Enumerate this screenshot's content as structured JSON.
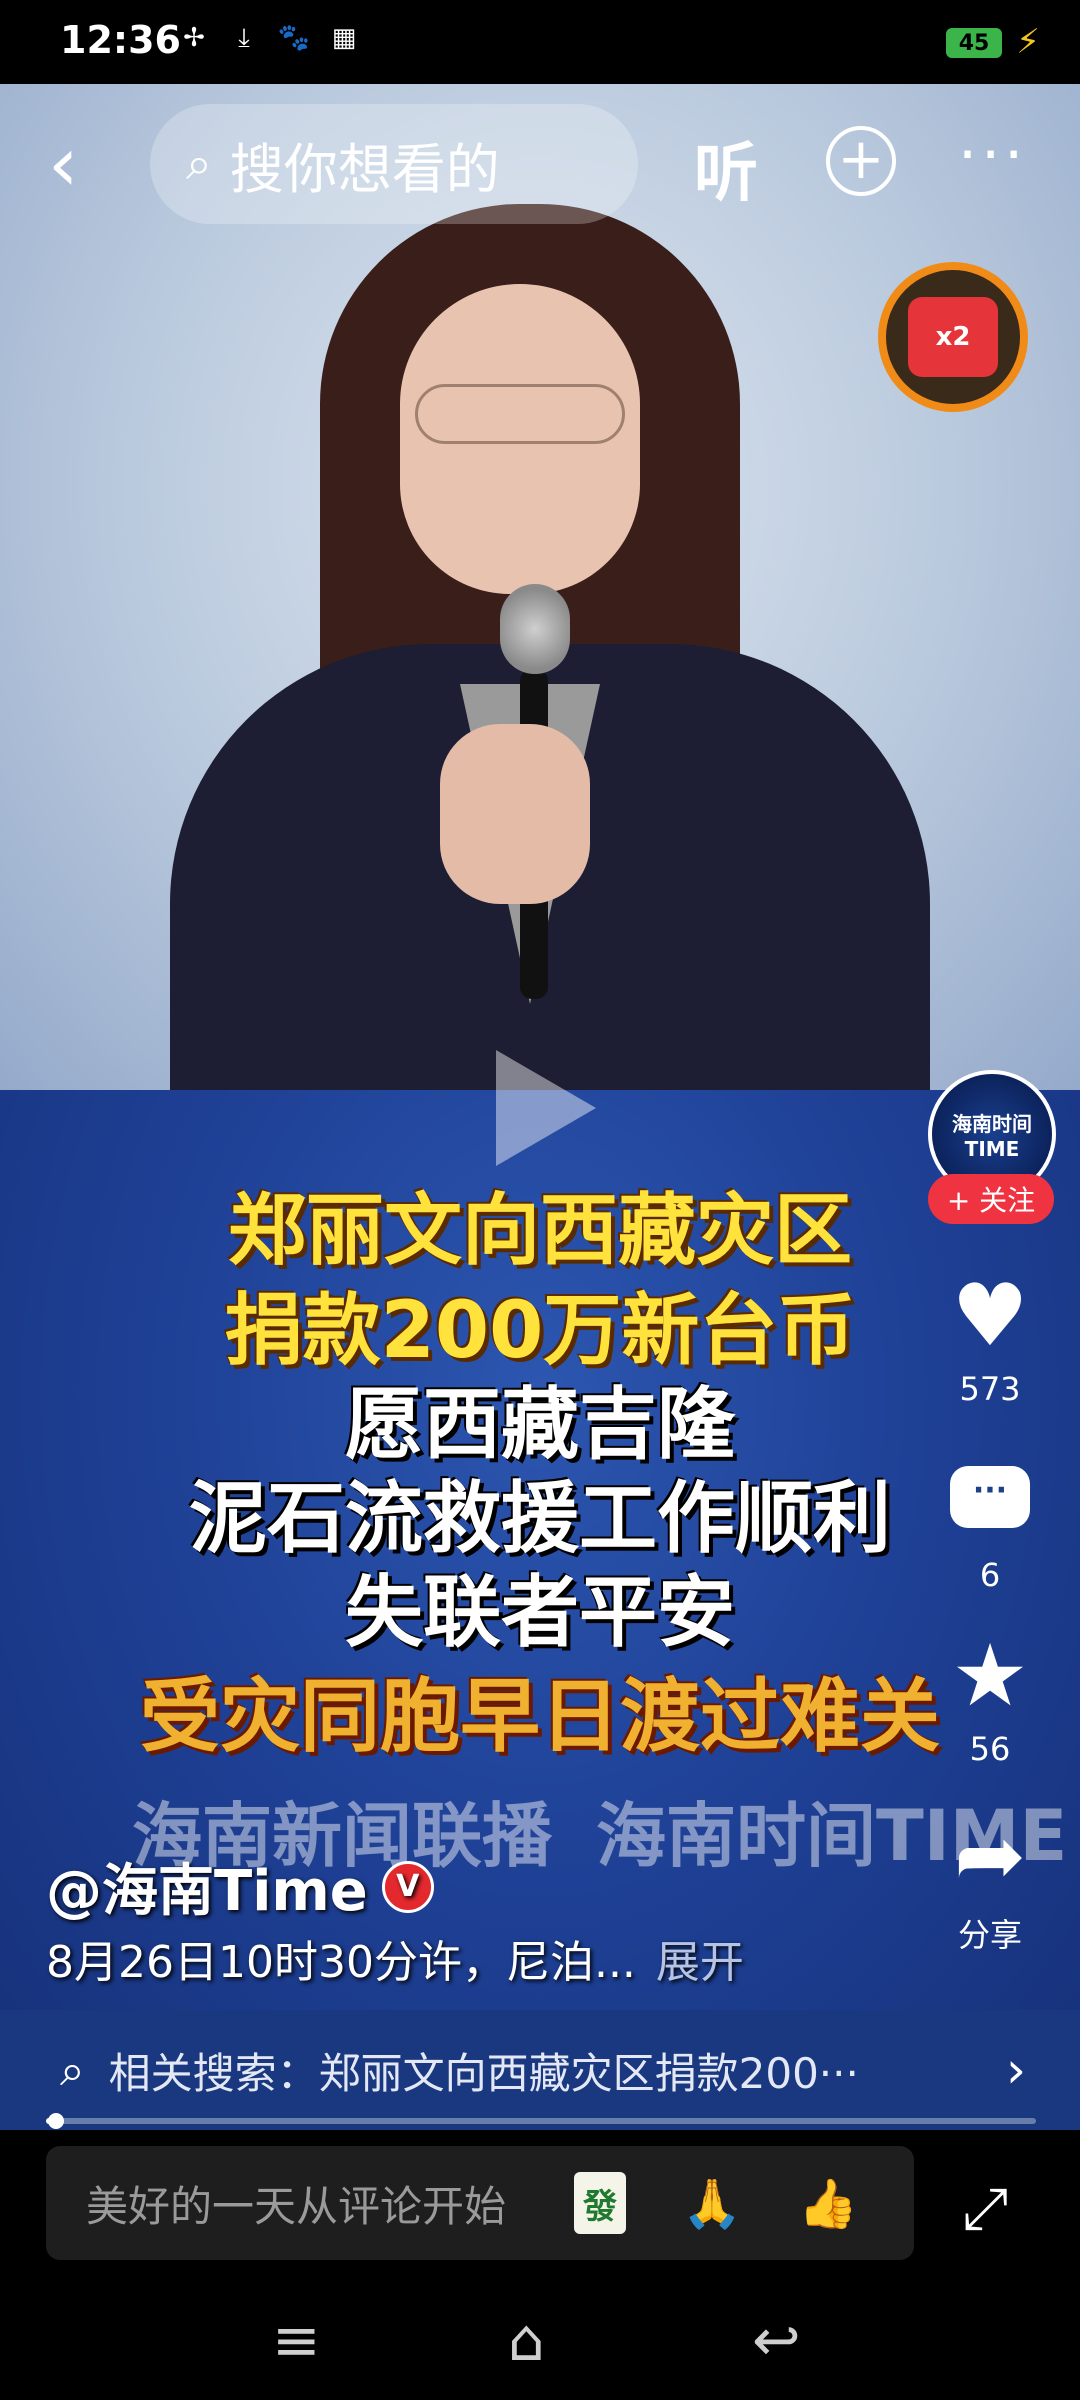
{
  "status_bar": {
    "time": "12:36",
    "battery": "45",
    "icons": [
      "fan-icon",
      "download-icon",
      "baidu-icon",
      "calendar-icon"
    ]
  },
  "top_bar": {
    "search_placeholder": "搜你想看的",
    "listen_label": "听"
  },
  "video": {
    "caption_lines": [
      "郑丽文向西藏灾区",
      "捐款200万新台币",
      "愿西藏吉隆",
      "泥石流救援工作顺利",
      "失联者平安",
      "受灾同胞早日渡过难关"
    ],
    "watermarks": [
      "海南新闻联播",
      "海南时间TIME"
    ],
    "reward_badge": "x2"
  },
  "rail": {
    "avatar_text": "海南时间TIME",
    "follow_label": "+ 关注",
    "like_count": "573",
    "comment_count": "6",
    "favorite_count": "56",
    "share_label": "分享"
  },
  "author": {
    "name": "@海南Time",
    "description": "8月26日10时30分许，尼泊...",
    "expand_label": "展开"
  },
  "related": {
    "text": "相关搜索：郑丽文向西藏灾区捐款200···"
  },
  "comment_bar": {
    "placeholder": "美好的一天从评论开始",
    "mahjong": "發"
  },
  "progress": {
    "value": 0.01
  },
  "colors": {
    "accent_red": "#ef3340",
    "caption_yellow": "#ffe23b",
    "caption_gold": "#f0b030",
    "battery_green": "#3bb54a"
  }
}
